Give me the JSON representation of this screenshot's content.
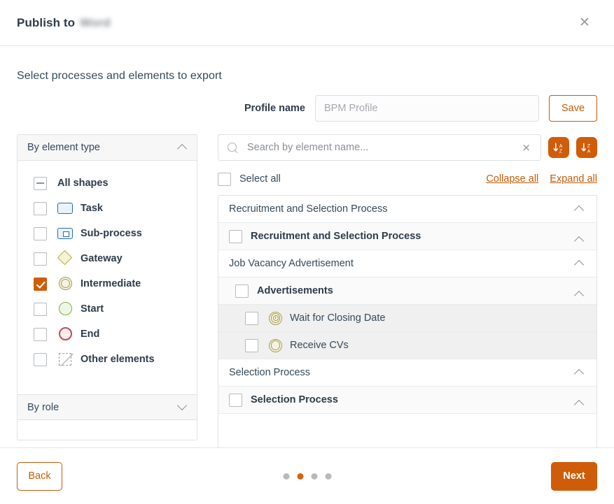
{
  "header": {
    "title_prefix": "Publish to",
    "title_target": "Word",
    "close_icon": "close-icon"
  },
  "subtitle": "Select processes and elements to export",
  "profile": {
    "label": "Profile name",
    "value": "",
    "placeholder": "BPM Profile",
    "save_label": "Save"
  },
  "search": {
    "value": "",
    "placeholder": "Search by element name...",
    "clear_glyph": "×",
    "sort_asc_title": "Sort A-Z",
    "sort_desc_title": "Sort Z-A"
  },
  "left_panel": {
    "by_element_type": {
      "label": "By element type",
      "expanded": true
    },
    "by_role": {
      "label": "By role",
      "expanded": false
    },
    "items": [
      {
        "label": "All shapes",
        "state": "indeterminate",
        "icon": ""
      },
      {
        "label": "Task",
        "state": "unchecked",
        "icon": "task-shape-icon"
      },
      {
        "label": "Sub-process",
        "state": "unchecked",
        "icon": "sub-process-shape-icon"
      },
      {
        "label": "Gateway",
        "state": "unchecked",
        "icon": "gateway-shape-icon"
      },
      {
        "label": "Intermediate",
        "state": "checked",
        "icon": "intermediate-event-icon"
      },
      {
        "label": "Start",
        "state": "unchecked",
        "icon": "start-event-icon"
      },
      {
        "label": "End",
        "state": "unchecked",
        "icon": "end-event-icon"
      },
      {
        "label": "Other elements",
        "state": "unchecked",
        "icon": "other-elements-icon"
      }
    ]
  },
  "tree_tools": {
    "select_all_label": "Select all",
    "select_all_state": "unchecked",
    "collapse_all_label": "Collapse all",
    "expand_all_label": "Expand all"
  },
  "tree": {
    "rows": [
      {
        "level": "group",
        "label": "Recruitment and Selection Process",
        "chevron": "up"
      },
      {
        "level": "item",
        "label": "Recruitment and Selection Process",
        "state": "unchecked",
        "chevron": "up"
      },
      {
        "level": "group",
        "label": "Job Vacancy Advertisement",
        "chevron": "up"
      },
      {
        "level": "item",
        "label": "Advertisements",
        "state": "unchecked",
        "chevron": "up"
      },
      {
        "level": "leaf",
        "label": "Wait for Closing Date",
        "state": "unchecked",
        "icon": "timer-intermediate-event-icon"
      },
      {
        "level": "leaf",
        "label": "Receive CVs",
        "state": "unchecked",
        "icon": "intermediate-event-icon"
      },
      {
        "level": "group",
        "label": "Selection Process",
        "chevron": "up"
      },
      {
        "level": "item",
        "label": "Selection Process",
        "state": "unchecked",
        "chevron": "up"
      }
    ]
  },
  "footer": {
    "back_label": "Back",
    "next_label": "Next",
    "steps_total": 4,
    "step_active_index": 2
  },
  "colors": {
    "accent": "#cf5c09",
    "accent_link": "#c45c08",
    "text": "#34495b",
    "border": "#e0e2e5",
    "row_leaf_bg": "#f0f0f0",
    "row_item_bg": "#fafafa"
  }
}
